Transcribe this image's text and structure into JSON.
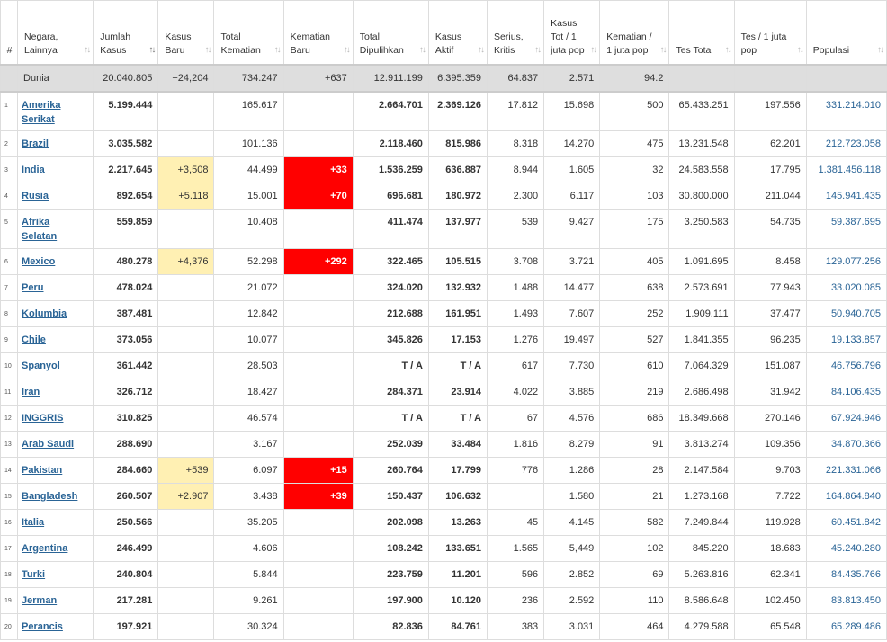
{
  "headers": [
    {
      "label": "#",
      "sortable": false
    },
    {
      "label": "Negara, Lainnya",
      "sortable": true
    },
    {
      "label": "Jumlah Kasus",
      "sortable": true,
      "active": true
    },
    {
      "label": "Kasus Baru",
      "sortable": true
    },
    {
      "label": "Total Kematian",
      "sortable": true
    },
    {
      "label": "Kematian Baru",
      "sortable": true
    },
    {
      "label": "Total Dipulihkan",
      "sortable": true
    },
    {
      "label": "Kasus Aktif",
      "sortable": true
    },
    {
      "label": "Serius, Kritis",
      "sortable": true
    },
    {
      "label": "Kasus Tot / 1 juta pop",
      "sortable": true
    },
    {
      "label": "Kematian / 1 juta pop",
      "sortable": true
    },
    {
      "label": "Tes Total",
      "sortable": true
    },
    {
      "label": "Tes / 1 juta pop",
      "sortable": true
    },
    {
      "label": "Populasi",
      "sortable": true
    }
  ],
  "world": {
    "name": "Dunia",
    "total_cases": "20.040.805",
    "new_cases": "+24,204",
    "total_deaths": "734.247",
    "new_deaths": "+637",
    "recovered": "12.911.199",
    "active": "6.395.359",
    "critical": "64.837",
    "cases_per_million": "2.571",
    "deaths_per_million": "94.2",
    "total_tests": "",
    "tests_per_million": "",
    "population": ""
  },
  "rows": [
    {
      "num": "1",
      "country": "Amerika Serikat",
      "total_cases": "5.199.444",
      "new_cases": "",
      "total_deaths": "165.617",
      "new_deaths": "",
      "recovered": "2.664.701",
      "active": "2.369.126",
      "critical": "17.812",
      "cases_per_million": "15.698",
      "deaths_per_million": "500",
      "total_tests": "65.433.251",
      "tests_per_million": "197.556",
      "population": "331.214.010"
    },
    {
      "num": "2",
      "country": "Brazil",
      "total_cases": "3.035.582",
      "new_cases": "",
      "total_deaths": "101.136",
      "new_deaths": "",
      "recovered": "2.118.460",
      "active": "815.986",
      "critical": "8.318",
      "cases_per_million": "14.270",
      "deaths_per_million": "475",
      "total_tests": "13.231.548",
      "tests_per_million": "62.201",
      "population": "212.723.058"
    },
    {
      "num": "3",
      "country": "India",
      "total_cases": "2.217.645",
      "new_cases": "+3,508",
      "total_deaths": "44.499",
      "new_deaths": "+33",
      "recovered": "1.536.259",
      "active": "636.887",
      "critical": "8.944",
      "cases_per_million": "1.605",
      "deaths_per_million": "32",
      "total_tests": "24.583.558",
      "tests_per_million": "17.795",
      "population": "1.381.456.118"
    },
    {
      "num": "4",
      "country": "Rusia",
      "total_cases": "892.654",
      "new_cases": "+5.118",
      "total_deaths": "15.001",
      "new_deaths": "+70",
      "recovered": "696.681",
      "active": "180.972",
      "critical": "2.300",
      "cases_per_million": "6.117",
      "deaths_per_million": "103",
      "total_tests": "30.800.000",
      "tests_per_million": "211.044",
      "population": "145.941.435"
    },
    {
      "num": "5",
      "country": "Afrika Selatan",
      "total_cases": "559.859",
      "new_cases": "",
      "total_deaths": "10.408",
      "new_deaths": "",
      "recovered": "411.474",
      "active": "137.977",
      "critical": "539",
      "cases_per_million": "9.427",
      "deaths_per_million": "175",
      "total_tests": "3.250.583",
      "tests_per_million": "54.735",
      "population": "59.387.695"
    },
    {
      "num": "6",
      "country": "Mexico",
      "total_cases": "480.278",
      "new_cases": "+4,376",
      "total_deaths": "52.298",
      "new_deaths": "+292",
      "recovered": "322.465",
      "active": "105.515",
      "critical": "3.708",
      "cases_per_million": "3.721",
      "deaths_per_million": "405",
      "total_tests": "1.091.695",
      "tests_per_million": "8.458",
      "population": "129.077.256"
    },
    {
      "num": "7",
      "country": "Peru",
      "total_cases": "478.024",
      "new_cases": "",
      "total_deaths": "21.072",
      "new_deaths": "",
      "recovered": "324.020",
      "active": "132.932",
      "critical": "1.488",
      "cases_per_million": "14.477",
      "deaths_per_million": "638",
      "total_tests": "2.573.691",
      "tests_per_million": "77.943",
      "population": "33.020.085"
    },
    {
      "num": "8",
      "country": "Kolumbia",
      "total_cases": "387.481",
      "new_cases": "",
      "total_deaths": "12.842",
      "new_deaths": "",
      "recovered": "212.688",
      "active": "161.951",
      "critical": "1.493",
      "cases_per_million": "7.607",
      "deaths_per_million": "252",
      "total_tests": "1.909.111",
      "tests_per_million": "37.477",
      "population": "50.940.705"
    },
    {
      "num": "9",
      "country": "Chile",
      "total_cases": "373.056",
      "new_cases": "",
      "total_deaths": "10.077",
      "new_deaths": "",
      "recovered": "345.826",
      "active": "17.153",
      "critical": "1.276",
      "cases_per_million": "19.497",
      "deaths_per_million": "527",
      "total_tests": "1.841.355",
      "tests_per_million": "96.235",
      "population": "19.133.857"
    },
    {
      "num": "10",
      "country": "Spanyol",
      "total_cases": "361.442",
      "new_cases": "",
      "total_deaths": "28.503",
      "new_deaths": "",
      "recovered": "T / A",
      "active": "T / A",
      "critical": "617",
      "cases_per_million": "7.730",
      "deaths_per_million": "610",
      "total_tests": "7.064.329",
      "tests_per_million": "151.087",
      "population": "46.756.796"
    },
    {
      "num": "11",
      "country": "Iran",
      "total_cases": "326.712",
      "new_cases": "",
      "total_deaths": "18.427",
      "new_deaths": "",
      "recovered": "284.371",
      "active": "23.914",
      "critical": "4.022",
      "cases_per_million": "3.885",
      "deaths_per_million": "219",
      "total_tests": "2.686.498",
      "tests_per_million": "31.942",
      "population": "84.106.435"
    },
    {
      "num": "12",
      "country": "INGGRIS",
      "total_cases": "310.825",
      "new_cases": "",
      "total_deaths": "46.574",
      "new_deaths": "",
      "recovered": "T / A",
      "active": "T / A",
      "critical": "67",
      "cases_per_million": "4.576",
      "deaths_per_million": "686",
      "total_tests": "18.349.668",
      "tests_per_million": "270.146",
      "population": "67.924.946"
    },
    {
      "num": "13",
      "country": "Arab Saudi",
      "total_cases": "288.690",
      "new_cases": "",
      "total_deaths": "3.167",
      "new_deaths": "",
      "recovered": "252.039",
      "active": "33.484",
      "critical": "1.816",
      "cases_per_million": "8.279",
      "deaths_per_million": "91",
      "total_tests": "3.813.274",
      "tests_per_million": "109.356",
      "population": "34.870.366"
    },
    {
      "num": "14",
      "country": "Pakistan",
      "total_cases": "284.660",
      "new_cases": "+539",
      "total_deaths": "6.097",
      "new_deaths": "+15",
      "recovered": "260.764",
      "active": "17.799",
      "critical": "776",
      "cases_per_million": "1.286",
      "deaths_per_million": "28",
      "total_tests": "2.147.584",
      "tests_per_million": "9.703",
      "population": "221.331.066"
    },
    {
      "num": "15",
      "country": "Bangladesh",
      "total_cases": "260.507",
      "new_cases": "+2.907",
      "total_deaths": "3.438",
      "new_deaths": "+39",
      "recovered": "150.437",
      "active": "106.632",
      "critical": "",
      "cases_per_million": "1.580",
      "deaths_per_million": "21",
      "total_tests": "1.273.168",
      "tests_per_million": "7.722",
      "population": "164.864.840"
    },
    {
      "num": "16",
      "country": "Italia",
      "total_cases": "250.566",
      "new_cases": "",
      "total_deaths": "35.205",
      "new_deaths": "",
      "recovered": "202.098",
      "active": "13.263",
      "critical": "45",
      "cases_per_million": "4.145",
      "deaths_per_million": "582",
      "total_tests": "7.249.844",
      "tests_per_million": "119.928",
      "population": "60.451.842"
    },
    {
      "num": "17",
      "country": "Argentina",
      "total_cases": "246.499",
      "new_cases": "",
      "total_deaths": "4.606",
      "new_deaths": "",
      "recovered": "108.242",
      "active": "133.651",
      "critical": "1.565",
      "cases_per_million": "5,449",
      "deaths_per_million": "102",
      "total_tests": "845.220",
      "tests_per_million": "18.683",
      "population": "45.240.280"
    },
    {
      "num": "18",
      "country": "Turki",
      "total_cases": "240.804",
      "new_cases": "",
      "total_deaths": "5.844",
      "new_deaths": "",
      "recovered": "223.759",
      "active": "11.201",
      "critical": "596",
      "cases_per_million": "2.852",
      "deaths_per_million": "69",
      "total_tests": "5.263.816",
      "tests_per_million": "62.341",
      "population": "84.435.766"
    },
    {
      "num": "19",
      "country": "Jerman",
      "total_cases": "217.281",
      "new_cases": "",
      "total_deaths": "9.261",
      "new_deaths": "",
      "recovered": "197.900",
      "active": "10.120",
      "critical": "236",
      "cases_per_million": "2.592",
      "deaths_per_million": "110",
      "total_tests": "8.586.648",
      "tests_per_million": "102.450",
      "population": "83.813.450"
    },
    {
      "num": "20",
      "country": "Perancis",
      "total_cases": "197.921",
      "new_cases": "",
      "total_deaths": "30.324",
      "new_deaths": "",
      "recovered": "82.836",
      "active": "84.761",
      "critical": "383",
      "cases_per_million": "3.031",
      "deaths_per_million": "464",
      "total_tests": "4.279.588",
      "tests_per_million": "65.548",
      "population": "65.289.486"
    }
  ]
}
